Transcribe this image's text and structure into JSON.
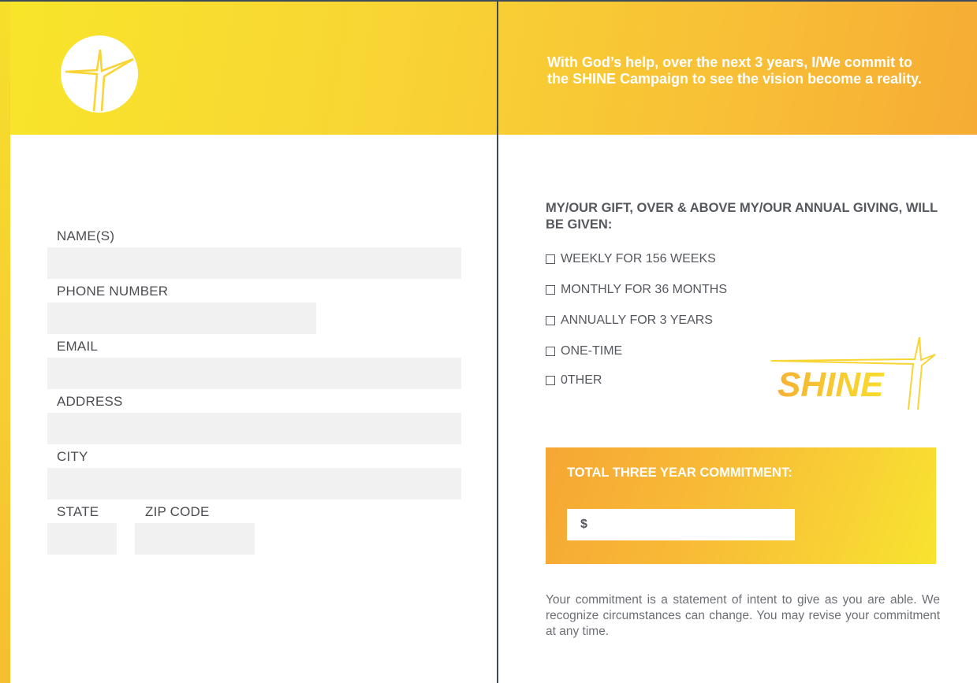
{
  "colors": {
    "brand_yellow": "#f8e52a",
    "brand_orange": "#f6ac34",
    "text_gray": "#55585e",
    "field_gray": "#f1f1f1",
    "rule_navy": "#3d4a5c"
  },
  "header": {
    "logo_icon": "star-in-circle-icon",
    "pledge_statement": "With God’s help, over the next 3 years, I/We commit to the SHINE Campaign to see the vision become a reality."
  },
  "form": {
    "fields": {
      "names": {
        "label": "NAME(S)",
        "value": ""
      },
      "phone": {
        "label": "PHONE NUMBER",
        "value": ""
      },
      "email": {
        "label": "EMAIL",
        "value": ""
      },
      "address": {
        "label": "ADDRESS",
        "value": ""
      },
      "city": {
        "label": "CITY",
        "value": ""
      },
      "state": {
        "label": "STATE",
        "value": ""
      },
      "zip": {
        "label": "ZIP CODE",
        "value": ""
      }
    }
  },
  "gift": {
    "heading": "MY/OUR GIFT, OVER & ABOVE MY/OUR ANNUAL GIVING, WILL BE GIVEN:",
    "options": [
      {
        "label": "WEEKLY FOR 156 WEEKS",
        "checked": false
      },
      {
        "label": "MONTHLY FOR 36 MONTHS",
        "checked": false
      },
      {
        "label": "ANNUALLY FOR 3 YEARS",
        "checked": false
      },
      {
        "label": "ONE-TIME",
        "checked": false
      },
      {
        "label": "0THER",
        "checked": false
      }
    ],
    "logo_text": "SHINE"
  },
  "total": {
    "title": "TOTAL THREE YEAR COMMITMENT:",
    "currency": "$",
    "amount": ""
  },
  "disclaimer": "Your commitment is a statement of intent to give as you are able. We recognize circumstances can change. You may revise your commitment at any time."
}
